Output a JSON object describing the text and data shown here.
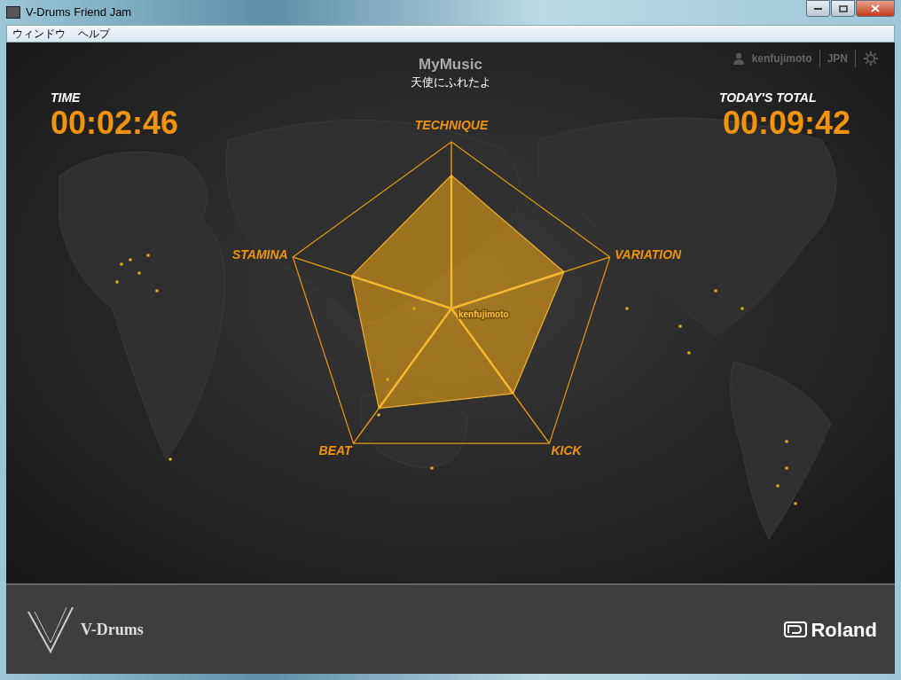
{
  "window": {
    "title": "V-Drums Friend Jam"
  },
  "menu": [
    "ウィンドウ",
    "ヘルプ"
  ],
  "header": {
    "user": "kenfujimoto",
    "region": "JPN"
  },
  "time": {
    "label": "TIME",
    "value": "00:02:46"
  },
  "total": {
    "label": "TODAY'S TOTAL",
    "value": "00:09:42"
  },
  "song": {
    "category": "MyMusic",
    "title": "天使にふれたよ"
  },
  "radar": {
    "player": "kenfujimoto",
    "axes": [
      {
        "label": "TECHNIQUE",
        "level": 0.8
      },
      {
        "label": "VARIATION",
        "level": 0.71
      },
      {
        "label": "KICK",
        "level": 0.63
      },
      {
        "label": "BEAT",
        "level": 0.74
      },
      {
        "label": "STAMINA",
        "level": 0.63
      }
    ]
  },
  "footer": {
    "left_logo": "V-Drums",
    "right_logo": "Roland"
  }
}
